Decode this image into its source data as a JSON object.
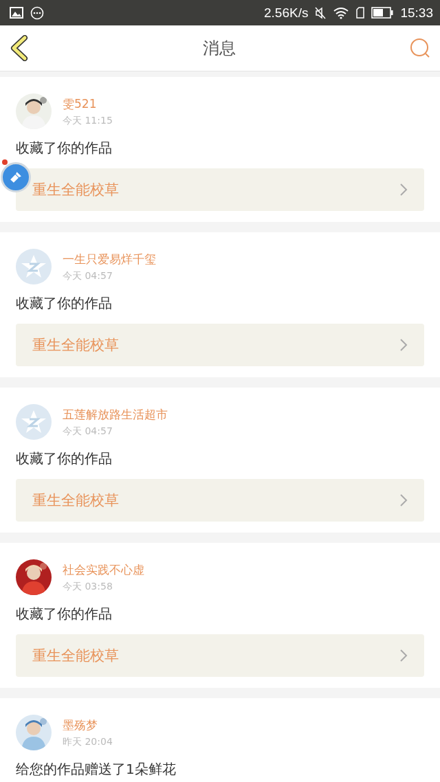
{
  "status_bar": {
    "speed": "2.56K/s",
    "time": "15:33"
  },
  "header": {
    "title": "消息"
  },
  "messages": [
    {
      "user": "雯521",
      "time": "今天 11:15",
      "text": "收藏了你的作品",
      "work": "重生全能校草"
    },
    {
      "user": "一生只爱易烊千玺",
      "time": "今天 04:57",
      "avatar": {
        "kind": "default"
      },
      "text": "收藏了你的作品",
      "work": "重生全能校草"
    },
    {
      "user": "五莲解放路生活超市",
      "time": "今天 04:57",
      "avatar": {
        "kind": "default"
      },
      "text": "收藏了你的作品",
      "work": "重生全能校草"
    },
    {
      "user": "社会实践不心虚",
      "time": "今天 03:58",
      "text": "收藏了你的作品",
      "work": "重生全能校草"
    },
    {
      "user": "墨殇梦",
      "time": "昨天 20:04",
      "text": "给您的作品赠送了1朵鲜花"
    }
  ]
}
